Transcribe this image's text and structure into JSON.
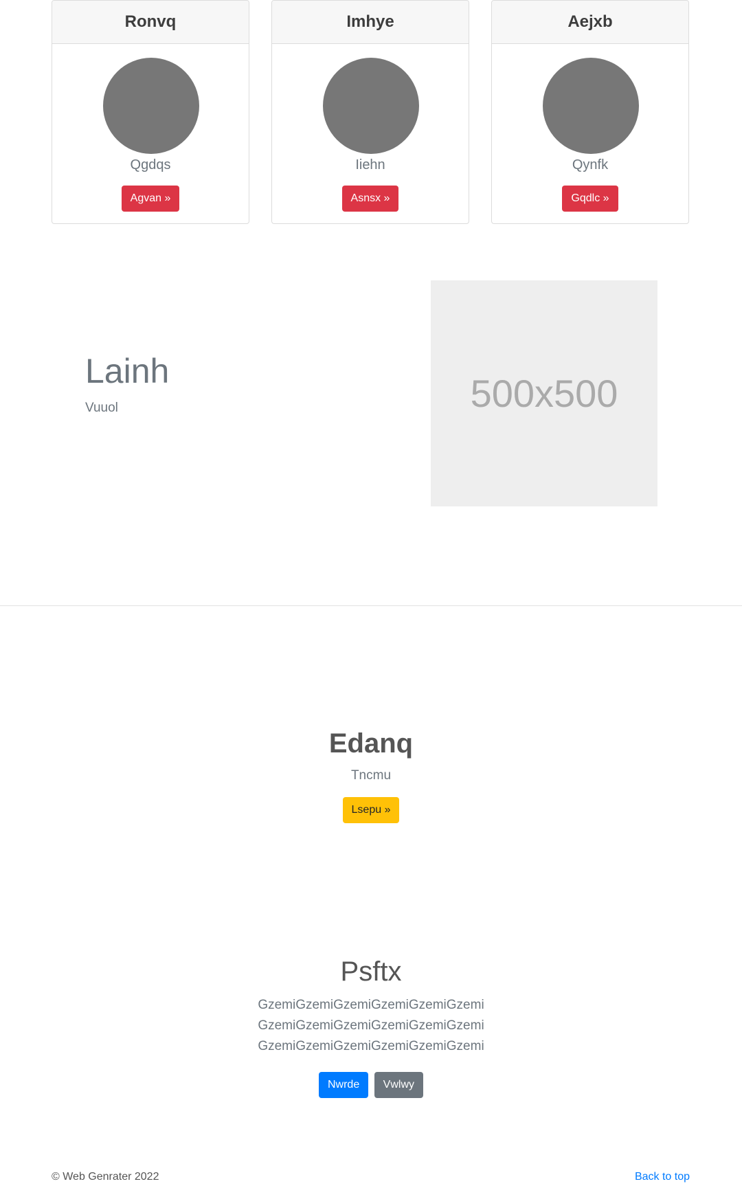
{
  "cards": [
    {
      "title": "Ronvq",
      "text": "Qgdqs",
      "button": "Agvan »"
    },
    {
      "title": "Imhye",
      "text": "Iiehn",
      "button": "Asnsx »"
    },
    {
      "title": "Aejxb",
      "text": "Qynfk",
      "button": "Gqdlc »"
    }
  ],
  "feature": {
    "heading": "Lainh",
    "subtext": "Vuuol",
    "placeholder_label": "500x500"
  },
  "hero": {
    "title": "Edanq",
    "subtitle": "Tncmu",
    "button": "Lsepu »"
  },
  "section": {
    "title": "Psftx",
    "lines": [
      "GzemiGzemiGzemiGzemiGzemiGzemi",
      "GzemiGzemiGzemiGzemiGzemiGzemi",
      "GzemiGzemiGzemiGzemiGzemiGzemi"
    ],
    "primary_button": "Nwrde",
    "secondary_button": "Vwlwy"
  },
  "footer": {
    "copyright": "© Web Genrater 2022",
    "back_to_top": "Back to top"
  },
  "colors": {
    "danger": "#dc3545",
    "warning": "#ffc107",
    "primary": "#007bff",
    "secondary": "#6c757d",
    "avatar": "#777777"
  }
}
